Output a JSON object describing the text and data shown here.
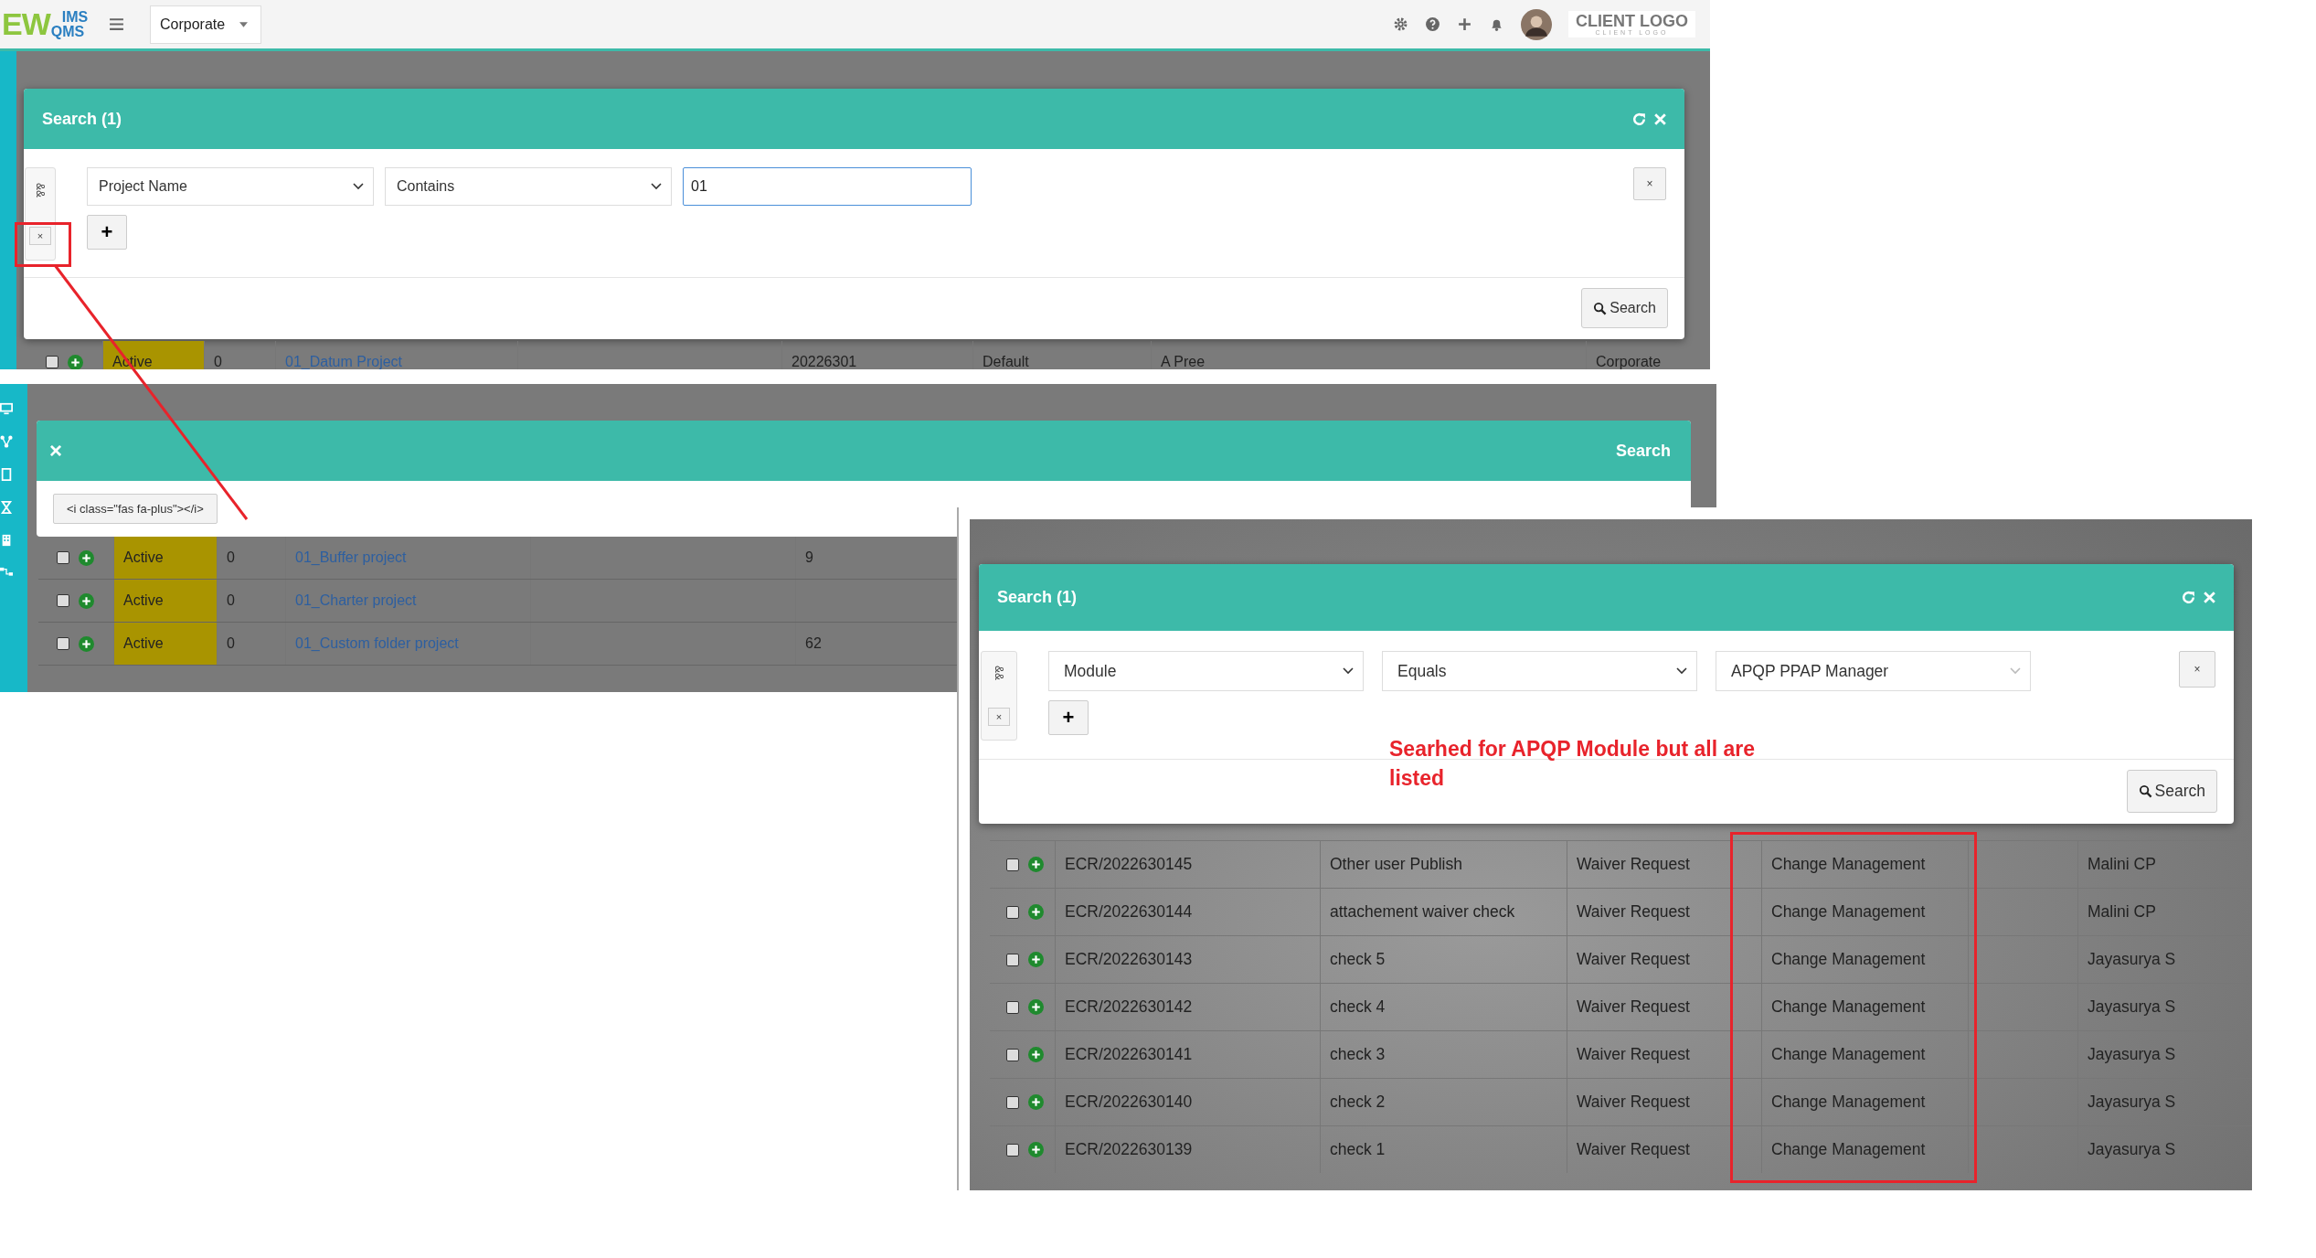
{
  "screenshot_1": {
    "top_bar": {
      "logo": {
        "main": "EW",
        "top": "IMS",
        "bottom": "QMS"
      },
      "company_select": "Corporate",
      "client_logo": "CLIENT LOGO",
      "client_logo_sub": "CLIENT LOGO"
    },
    "search_modal": {
      "title": "Search (1)",
      "group_operator": "&&",
      "group_remove": "×",
      "condition": {
        "field": "Project Name",
        "operator": "Contains",
        "value": "01",
        "kind": "input"
      },
      "row_remove": "×",
      "add_button": "+",
      "search_button": "Search"
    },
    "rows": [
      {
        "checked": false,
        "status": "Active",
        "count": "0",
        "name": "01_Datum Project",
        "column_5": "20226301",
        "column_6": "Default",
        "column_7": "A Pree",
        "column_8": "Corporate"
      }
    ]
  },
  "screenshot_2": {
    "modal": {
      "close": "×",
      "title": "Search",
      "button": "<i class=\"fas fa-plus\"></i>"
    },
    "rows": [
      {
        "checked": false,
        "status": "Active",
        "count": "0",
        "name": "01_Buffer project",
        "column_5": "9"
      },
      {
        "checked": false,
        "status": "Active",
        "count": "0",
        "name": "01_Charter project"
      },
      {
        "checked": false,
        "status": "Active",
        "count": "0",
        "name": "01_Custom folder project",
        "column_5": "62"
      }
    ]
  },
  "screenshot_3": {
    "search_modal": {
      "title": "Search (1)",
      "group_operator": "&&",
      "group_remove": "×",
      "condition": {
        "field": "Module",
        "operator": "Equals",
        "value": "APQP PPAP Manager",
        "kind": "select"
      },
      "row_remove": "×",
      "add_button": "+",
      "search_button": "Search"
    },
    "rows": [
      {
        "checked": false,
        "id": "ECR/2022630145",
        "title": "Other user Publish",
        "type": "Waiver Request",
        "module": "Change Management",
        "owner": "Malini CP"
      },
      {
        "checked": false,
        "id": "ECR/2022630144",
        "title": "attachement waiver check",
        "type": "Waiver Request",
        "module": "Change Management",
        "owner": "Malini CP"
      },
      {
        "checked": false,
        "id": "ECR/2022630143",
        "title": "check 5",
        "type": "Waiver Request",
        "module": "Change Management",
        "owner": "Jayasurya S"
      },
      {
        "checked": false,
        "id": "ECR/2022630142",
        "title": "check 4",
        "type": "Waiver Request",
        "module": "Change Management",
        "owner": "Jayasurya S"
      },
      {
        "checked": false,
        "id": "ECR/2022630141",
        "title": "check 3",
        "type": "Waiver Request",
        "module": "Change Management",
        "owner": "Jayasurya S"
      },
      {
        "checked": false,
        "id": "ECR/2022630140",
        "title": "check 2",
        "type": "Waiver Request",
        "module": "Change Management",
        "owner": "Jayasurya S"
      },
      {
        "checked": false,
        "id": "ECR/2022630139",
        "title": "check 1",
        "type": "Waiver Request",
        "module": "Change Management",
        "owner": "Jayasurya S"
      }
    ]
  },
  "annotation": {
    "note": "Searhed for APQP Module but all are listed"
  }
}
